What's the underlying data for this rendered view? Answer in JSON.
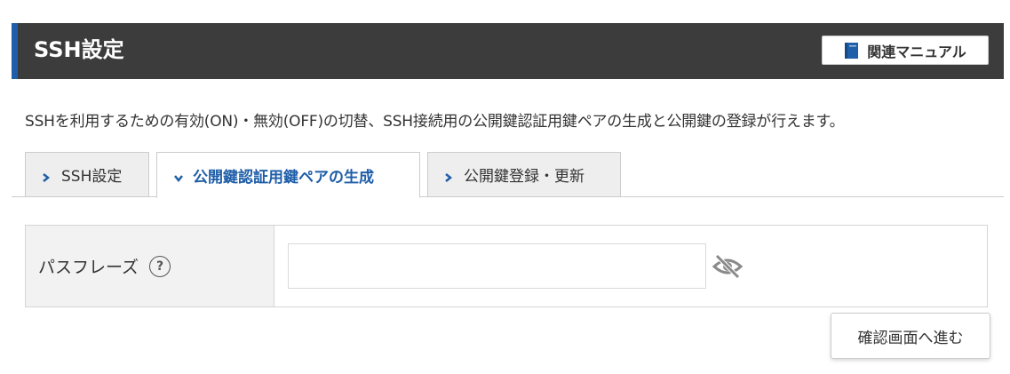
{
  "header": {
    "title": "SSH設定",
    "manual_button_label": "関連マニュアル",
    "manual_icon": "book-icon"
  },
  "description": "SSHを利用するための有効(ON)・無効(OFF)の切替、SSH接続用の公開鍵認証用鍵ペアの生成と公開鍵の登録が行えます。",
  "tabs": [
    {
      "label": "SSH設定",
      "active": false
    },
    {
      "label": "公開鍵認証用鍵ペアの生成",
      "active": true
    },
    {
      "label": "公開鍵登録・更新",
      "active": false
    }
  ],
  "form": {
    "passphrase_label": "パスフレーズ",
    "help_symbol": "?",
    "passphrase_value": "",
    "visibility_icon": "eye-slash-icon"
  },
  "confirm_button_label": "確認画面へ進む",
  "colors": {
    "header_bg": "#3c3c3c",
    "accent": "#1f5ea8",
    "label_cell_bg": "#f2f2f2",
    "inactive_tab_bg": "#eeeeee"
  }
}
